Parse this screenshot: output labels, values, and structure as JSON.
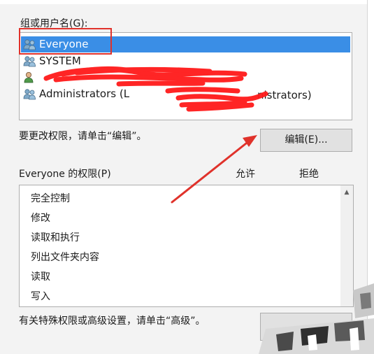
{
  "groups_label": "组或用户名(G):",
  "users": [
    {
      "name": "Everyone",
      "icon": "users-group-icon",
      "selected": true
    },
    {
      "name": "SYSTEM",
      "icon": "users-group-icon",
      "selected": false
    },
    {
      "name": "",
      "icon": "user-icon",
      "selected": false
    },
    {
      "name": "Administrators (L",
      "icon": "users-group-icon",
      "selected": false
    }
  ],
  "admin_suffix": "nistrators)",
  "change_hint": "要更改权限，请单击“编辑”。",
  "edit_button": "编辑(E)...",
  "permissions_for": "Everyone 的权限(P)",
  "allow_header": "允许",
  "deny_header": "拒绝",
  "permissions": [
    "完全控制",
    "修改",
    "读取和执行",
    "列出文件夹内容",
    "读取",
    "写入"
  ],
  "advanced_hint": "有关特殊权限或高级设置，请单击“高级”。",
  "colors": {
    "selection": "#3a8ee6",
    "annotation_red": "#e0322b",
    "scribble_red": "#ff1a1a"
  }
}
